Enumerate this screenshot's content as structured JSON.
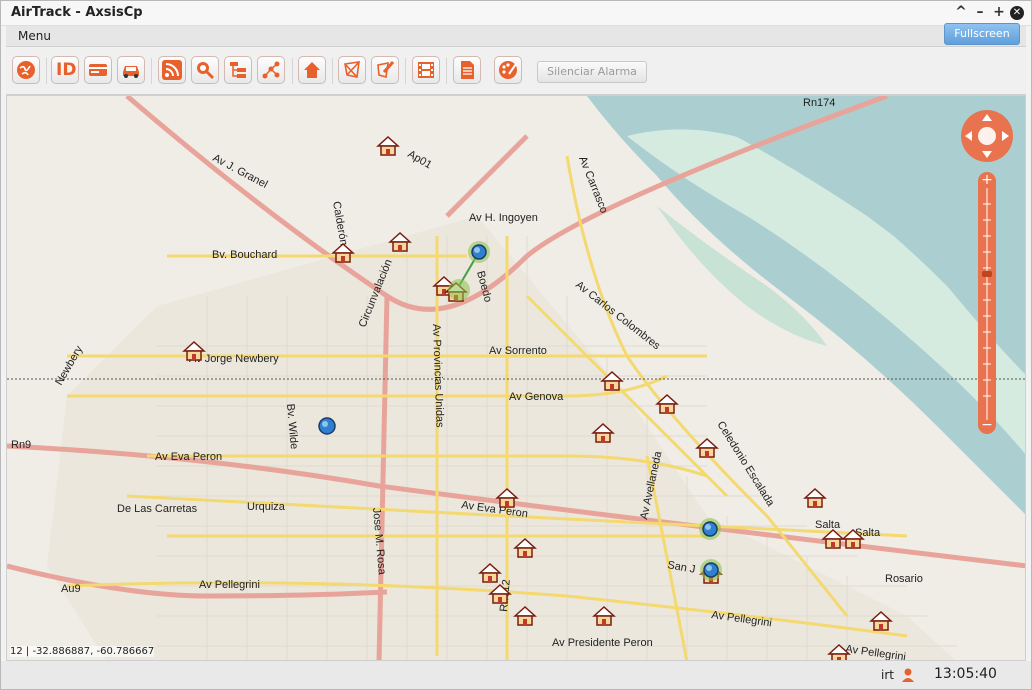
{
  "window": {
    "title": "AirTrack - AxsisCp",
    "controls": [
      "^",
      "–",
      "+",
      "✕"
    ]
  },
  "menu": {
    "label": "Menu",
    "fullscreen_label": "Fullscreen"
  },
  "toolbar": {
    "buttons": [
      "globe-icon",
      "id-icon",
      "card-icon",
      "car-icon",
      "rss-icon",
      "search-icon",
      "tree-icon",
      "network-icon",
      "home-icon",
      "polygon-icon",
      "polygon-edit-icon",
      "film-icon",
      "document-icon",
      "palette-icon"
    ],
    "id_label": "ID",
    "silenciar_label": "Silenciar Alarma",
    "accent": "#e8612c"
  },
  "map": {
    "streets": [
      "Rn174",
      "Ap01",
      "Av J. Granel",
      "Calderón",
      "Av H. Ingoyen",
      "Av Carrasco",
      "Bv. Bouchard",
      "Boedo",
      "Circunvalación",
      "Av Carlos Colombres",
      "Av Provincias Unidas",
      "Av Sorrento",
      "Av Jorge Newbery",
      "Newbery",
      "Av Genova",
      "Bv. Wilde",
      "Rn9",
      "Av Eva Peron",
      "Celedonio Escalada",
      "Av Avellaneda",
      "De Las Carretas",
      "Urquiza",
      "Av Eva Peron",
      "Salta",
      "Salta",
      "Jose M. Rosa",
      "San J",
      "Au9",
      "Av Pellegrini",
      "Rosario",
      "Av Pellegrini",
      "Rn012",
      "Av Presidente Peron",
      "Av Pellegrini"
    ],
    "coordinates": "12 | -32.886887, -60.786667"
  },
  "status": {
    "user": "irt",
    "time": "13:05:40"
  }
}
